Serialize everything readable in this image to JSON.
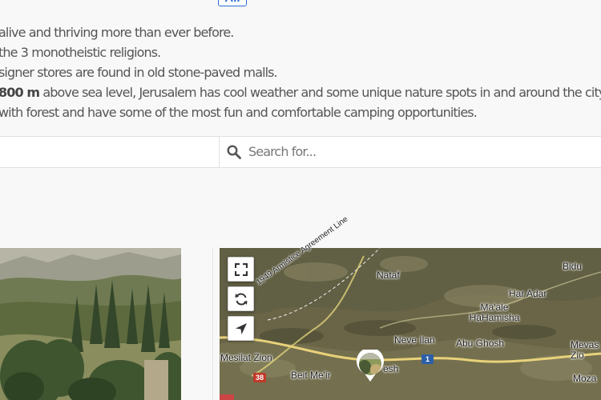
{
  "header": {
    "pill_label": "All"
  },
  "intro_lines": [
    {
      "text": "alive and thriving more than ever before."
    },
    {
      "text": "the 3 monotheistic religions."
    },
    {
      "text": "signer stores are found in old stone-paved malls."
    },
    {
      "bold": "800 m",
      "text": " above sea level, Jerusalem has cool weather and some unique nature spots in and around the city."
    },
    {
      "text": "with forest and have some of the most fun and comfortable camping opportunities."
    }
  ],
  "search": {
    "placeholder": "Search for..."
  },
  "map": {
    "labels": {
      "nataf": "Nataf",
      "bidu": "Bidu",
      "har_adar": "Har Adar",
      "maale_hahamisha": "Ma'ale HaHamisha",
      "neve_ilan": "Neve Ilan",
      "abu_ghosh": "Abu Ghosh",
      "mevaseret_zion": "Mevas Zio",
      "mesilat_zion": "Mesilat Zion",
      "beit_meir": "Beit Me'ir",
      "shoresh": "esh",
      "moza": "Moza",
      "armistice": "1949 Armistice Agreement Line",
      "road_38": "38",
      "road_1": "1"
    }
  }
}
